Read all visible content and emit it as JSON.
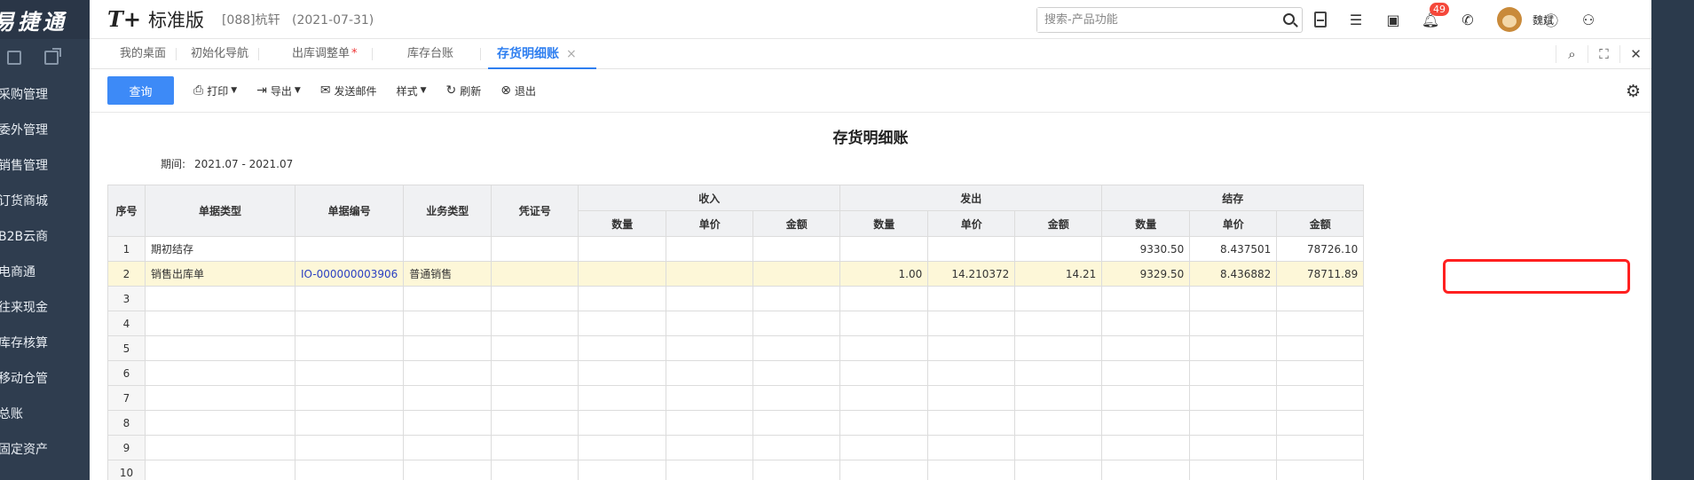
{
  "sidebar": {
    "brand": "易捷通",
    "items": [
      {
        "label": "采购管理"
      },
      {
        "label": "委外管理"
      },
      {
        "label": "销售管理"
      },
      {
        "label": "订货商城"
      },
      {
        "label": "B2B云商"
      },
      {
        "label": "电商通"
      },
      {
        "label": "往来现金"
      },
      {
        "label": "库存核算"
      },
      {
        "label": "移动仓管"
      },
      {
        "label": "总账"
      },
      {
        "label": "固定资产"
      }
    ]
  },
  "header": {
    "logo_mark": "T+",
    "product_name": "标准版",
    "account": "[088]杭轩",
    "date": "(2021-07-31)",
    "search_placeholder": "搜索-产品功能",
    "notification_count": "49",
    "username": "魏斌"
  },
  "tabs": [
    {
      "label": "我的桌面"
    },
    {
      "label": "初始化导航"
    },
    {
      "label": "出库调整单",
      "modified": "*"
    },
    {
      "label": "库存台账"
    },
    {
      "label": "存货明细账",
      "close": "×"
    }
  ],
  "toolbar": {
    "query": "查询",
    "print": "打印",
    "export": "导出",
    "send_mail": "发送邮件",
    "style": "样式",
    "refresh": "刷新",
    "exit": "退出"
  },
  "report": {
    "title": "存货明细账",
    "period_label": "期间:",
    "period_value": "2021.07 - 2021.07",
    "headers": {
      "seq": "序号",
      "doc_type": "单据类型",
      "doc_no": "单据编号",
      "biz_type": "业务类型",
      "voucher": "凭证号",
      "receive": "收入",
      "issue": "发出",
      "balance": "结存",
      "qty": "数量",
      "price": "单价",
      "amount": "金额"
    },
    "rows": [
      {
        "seq": "1",
        "doc_type": "期初结存",
        "doc_no": "",
        "biz_type": "",
        "voucher": "",
        "in_qty": "",
        "in_price": "",
        "in_amount": "",
        "out_qty": "",
        "out_price": "",
        "out_amount": "",
        "bal_qty": "9330.50",
        "bal_price": "8.437501",
        "bal_amount": "78726.10"
      },
      {
        "seq": "2",
        "doc_type": "销售出库单",
        "doc_no": "IO-000000003906",
        "biz_type": "普通销售",
        "voucher": "",
        "in_qty": "",
        "in_price": "",
        "in_amount": "",
        "out_qty": "1.00",
        "out_price": "14.210372",
        "out_amount": "14.21",
        "bal_qty": "9329.50",
        "bal_price": "8.436882",
        "bal_amount": "78711.89"
      },
      {
        "seq": "3"
      },
      {
        "seq": "4"
      },
      {
        "seq": "5"
      },
      {
        "seq": "6"
      },
      {
        "seq": "7"
      },
      {
        "seq": "8"
      },
      {
        "seq": "9"
      },
      {
        "seq": "10"
      }
    ]
  }
}
